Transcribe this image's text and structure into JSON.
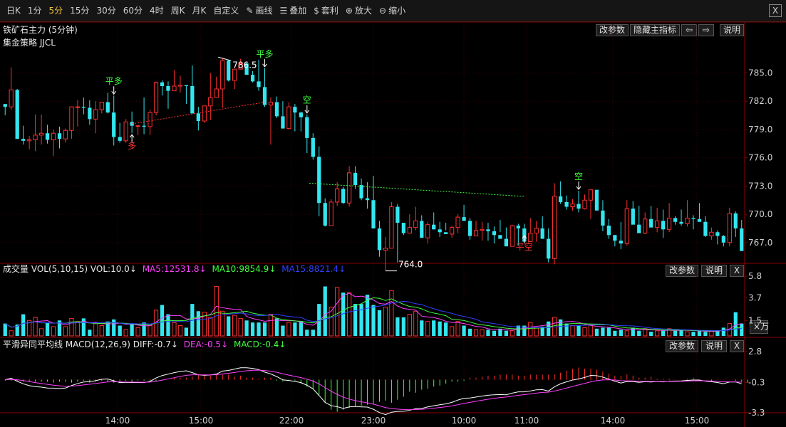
{
  "toolbar": {
    "items": [
      "日K",
      "1分",
      "5分",
      "15分",
      "30分",
      "60分",
      "4时",
      "周K",
      "月K",
      "自定义"
    ],
    "active_index": 2,
    "tools": [
      {
        "label": "画线",
        "icon": "pencil-icon"
      },
      {
        "label": "叠加",
        "icon": "stack-icon"
      },
      {
        "label": "套利",
        "icon": "money-bag-icon"
      },
      {
        "label": "放大",
        "icon": "zoom-in-icon"
      },
      {
        "label": "缩小",
        "icon": "zoom-out-icon"
      }
    ],
    "close_label": "X"
  },
  "main": {
    "title": "铁矿石主力 (5分钟)",
    "strategy": "集金策略 JJCL",
    "buttons": {
      "params": "改参数",
      "hide": "隐藏主指标",
      "prev": "⇦",
      "next": "⇨",
      "help": "说明"
    },
    "high_label": "786.5",
    "low_label": "764.0"
  },
  "vol": {
    "title": "成交量 VOL(5,10,15) VOL:10.0↓",
    "ma5": "MA5:12531.8↓",
    "ma10": "MA10:9854.9↓",
    "ma15": "MA15:8821.4↓",
    "buttons": {
      "params": "改参数",
      "help": "说明",
      "close": "X"
    },
    "unit_button": "×万"
  },
  "macd": {
    "title": "平滑异同平均线 MACD(12,26,9) DIFF:-0.7↓",
    "dea": "DEA:-0.5↓",
    "macd": "MACD:-0.4↓",
    "buttons": {
      "params": "改参数",
      "help": "说明",
      "close": "X"
    }
  },
  "colors": {
    "up": "#ff3030",
    "down": "#33e6f0",
    "ma5": "#ff40ff",
    "ma10": "#40ff40",
    "ma15": "#3040ff",
    "diff": "#ffffff",
    "dea": "#ff40ff",
    "bg": "#000000",
    "grid": "#2a0000"
  },
  "chart_data": {
    "type": "candlestick",
    "price_ylim": [
      764.0,
      786.5
    ],
    "price_ticks": [
      "785.0",
      "782.0",
      "779.0",
      "776.0",
      "773.0",
      "770.0",
      "767.0"
    ],
    "vol_ticks": [
      "5.8",
      "3.7",
      "1.5"
    ],
    "vol_ylim": [
      0,
      5.8
    ],
    "macd_ticks": [
      "2.8",
      "-0.3",
      "-3.3"
    ],
    "macd_ylim": [
      -3.3,
      2.8
    ],
    "x_ticks": [
      "14:00",
      "15:00",
      "22:00",
      "23:00",
      "10:00",
      "11:00",
      "14:00",
      "15:00"
    ],
    "signals": [
      {
        "label": "平多",
        "color": "#40ff40",
        "bar": 18
      },
      {
        "label": "多",
        "color": "#ff3030",
        "bar": 21
      },
      {
        "label": "平多",
        "color": "#40ff40",
        "bar": 43
      },
      {
        "label": "空",
        "color": "#40ff40",
        "bar": 50
      },
      {
        "label": "平空",
        "color": "#ff3030",
        "bar": 86
      },
      {
        "label": "空",
        "color": "#40ff40",
        "bar": 95
      }
    ],
    "candles": [
      [
        781.7,
        781.7,
        780.5,
        781.4
      ],
      [
        781.4,
        785.6,
        781.1,
        783.2
      ],
      [
        783.2,
        783.3,
        778.0,
        778.0
      ],
      [
        778.0,
        779.4,
        777.4,
        777.8
      ],
      [
        777.8,
        778.3,
        776.9,
        777.9
      ],
      [
        777.9,
        780.6,
        776.7,
        778.4
      ],
      [
        778.4,
        780.6,
        777.4,
        778.6
      ],
      [
        778.6,
        779.5,
        777.5,
        777.9
      ],
      [
        777.9,
        779.0,
        776.2,
        778.6
      ],
      [
        778.6,
        779.3,
        777.0,
        778.0
      ],
      [
        778.0,
        779.1,
        777.6,
        778.9
      ],
      [
        778.9,
        781.4,
        778.0,
        781.4
      ],
      [
        781.4,
        782.1,
        779.3,
        781.4
      ],
      [
        781.4,
        782.4,
        780.6,
        781.3
      ],
      [
        781.3,
        782.1,
        779.5,
        780.1
      ],
      [
        780.1,
        782.0,
        778.6,
        781.1
      ],
      [
        781.1,
        781.7,
        780.7,
        781.9
      ],
      [
        781.9,
        782.9,
        780.7,
        780.8
      ],
      [
        780.8,
        782.6,
        777.3,
        778.2
      ],
      [
        778.2,
        779.7,
        777.6,
        777.8
      ],
      [
        777.8,
        780.1,
        777.6,
        779.8
      ],
      [
        779.8,
        780.9,
        778.6,
        779.4
      ],
      [
        779.4,
        779.4,
        778.4,
        779.4
      ],
      [
        779.4,
        782.4,
        778.5,
        779.3
      ],
      [
        779.3,
        781.1,
        778.4,
        780.8
      ],
      [
        780.8,
        784.1,
        780.5,
        784.0
      ],
      [
        784.0,
        784.2,
        782.6,
        783.6
      ],
      [
        783.6,
        784.1,
        781.2,
        783.1
      ],
      [
        783.1,
        785.3,
        783.1,
        783.6
      ],
      [
        783.6,
        784.7,
        782.9,
        783.7
      ],
      [
        783.7,
        783.7,
        781.7,
        783.6
      ],
      [
        783.6,
        785.8,
        781.1,
        780.7
      ],
      [
        780.7,
        781.4,
        778.9,
        779.9
      ],
      [
        779.9,
        780.6,
        779.7,
        781.5
      ],
      [
        781.5,
        785.0,
        780.0,
        782.4
      ],
      [
        782.4,
        784.6,
        782.5,
        783.3
      ],
      [
        783.3,
        786.6,
        781.3,
        786.3
      ],
      [
        786.3,
        786.4,
        784.1,
        784.2
      ],
      [
        784.2,
        785.3,
        783.3,
        785.4
      ],
      [
        785.4,
        786.5,
        785.5,
        786.0
      ],
      [
        786.0,
        786.1,
        785.2,
        784.8
      ],
      [
        784.8,
        785.2,
        784.0,
        784.1
      ],
      [
        784.1,
        786.4,
        783.1,
        783.5
      ],
      [
        783.5,
        785.5,
        781.4,
        781.6
      ],
      [
        781.6,
        782.4,
        777.4,
        781.9
      ],
      [
        781.9,
        782.5,
        780.2,
        780.4
      ],
      [
        780.4,
        782.0,
        780.4,
        779.1
      ],
      [
        779.1,
        781.9,
        779.0,
        781.4
      ],
      [
        781.4,
        781.7,
        778.8,
        780.8
      ],
      [
        780.8,
        780.9,
        778.8,
        780.3
      ],
      [
        780.3,
        780.6,
        776.5,
        778.1
      ],
      [
        778.1,
        778.6,
        775.8,
        776.1
      ],
      [
        776.1,
        777.2,
        769.8,
        771.2
      ],
      [
        771.2,
        771.7,
        768.7,
        768.8
      ],
      [
        768.8,
        771.6,
        769.2,
        771.3
      ],
      [
        771.3,
        773.4,
        770.9,
        772.7
      ],
      [
        772.7,
        772.9,
        771.1,
        771.2
      ],
      [
        771.2,
        775.1,
        770.8,
        774.4
      ],
      [
        774.4,
        775.1,
        772.7,
        773.1
      ],
      [
        773.1,
        773.8,
        771.5,
        771.7
      ],
      [
        771.7,
        773.4,
        770.6,
        771.5
      ],
      [
        771.5,
        774.1,
        770.9,
        768.5
      ],
      [
        768.5,
        769.3,
        765.5,
        766.2
      ],
      [
        766.2,
        767.6,
        764.0,
        766.4
      ],
      [
        766.4,
        771.3,
        767.2,
        770.8
      ],
      [
        770.8,
        771.1,
        764.9,
        769.1
      ],
      [
        769.1,
        769.1,
        767.8,
        768.0
      ],
      [
        768.0,
        770.0,
        768.0,
        768.6
      ],
      [
        768.6,
        770.8,
        768.3,
        769.3
      ],
      [
        769.3,
        769.9,
        767.6,
        767.5
      ],
      [
        767.5,
        769.2,
        766.9,
        768.9
      ],
      [
        768.9,
        770.2,
        768.4,
        768.4
      ],
      [
        768.4,
        769.2,
        767.6,
        768.1
      ],
      [
        768.1,
        769.1,
        768.3,
        767.9
      ],
      [
        767.9,
        768.8,
        767.5,
        768.6
      ],
      [
        768.6,
        770.0,
        768.0,
        769.7
      ],
      [
        769.7,
        771.0,
        769.4,
        769.3
      ],
      [
        769.3,
        769.6,
        767.3,
        767.7
      ],
      [
        767.7,
        769.3,
        767.8,
        768.3
      ],
      [
        768.3,
        769.2,
        767.2,
        768.4
      ],
      [
        768.4,
        769.1,
        767.2,
        768.2
      ],
      [
        768.2,
        768.7,
        766.9,
        767.8
      ],
      [
        767.8,
        769.4,
        768.1,
        767.4
      ],
      [
        767.4,
        768.6,
        767.1,
        766.6
      ],
      [
        766.6,
        768.9,
        767.0,
        768.8
      ],
      [
        768.8,
        769.0,
        766.7,
        768.5
      ],
      [
        768.5,
        769.0,
        767.9,
        767.1
      ],
      [
        767.1,
        769.6,
        767.1,
        768.0
      ],
      [
        768.0,
        769.3,
        767.1,
        768.5
      ],
      [
        768.5,
        769.8,
        767.5,
        767.4
      ],
      [
        767.4,
        768.5,
        764.9,
        765.3
      ],
      [
        765.3,
        773.3,
        764.7,
        771.9
      ],
      [
        771.9,
        773.5,
        771.1,
        771.3
      ],
      [
        771.3,
        772.0,
        770.5,
        770.8
      ],
      [
        770.8,
        771.6,
        770.4,
        771.1
      ],
      [
        771.1,
        772.5,
        770.2,
        770.6
      ],
      [
        770.6,
        772.1,
        770.5,
        771.5
      ],
      [
        771.5,
        772.4,
        769.5,
        772.6
      ],
      [
        772.6,
        772.5,
        771.8,
        770.4
      ],
      [
        770.4,
        771.5,
        768.2,
        768.8
      ],
      [
        768.8,
        769.5,
        767.4,
        767.8
      ],
      [
        767.8,
        767.8,
        766.6,
        767.2
      ],
      [
        767.2,
        769.2,
        766.3,
        766.9
      ],
      [
        766.9,
        771.5,
        766.7,
        770.6
      ],
      [
        770.6,
        771.4,
        769.5,
        768.9
      ],
      [
        768.9,
        770.9,
        768.6,
        768.0
      ],
      [
        768.0,
        770.2,
        767.9,
        769.5
      ],
      [
        769.5,
        770.9,
        768.7,
        768.6
      ],
      [
        768.6,
        770.7,
        768.1,
        769.3
      ],
      [
        769.3,
        770.5,
        767.5,
        768.4
      ],
      [
        768.4,
        771.2,
        768.1,
        769.6
      ],
      [
        769.6,
        769.8,
        768.9,
        769.2
      ],
      [
        769.2,
        770.5,
        768.8,
        769.0
      ],
      [
        769.0,
        771.5,
        768.7,
        769.6
      ],
      [
        769.6,
        769.9,
        768.4,
        769.5
      ],
      [
        769.5,
        771.2,
        769.5,
        769.2
      ],
      [
        769.2,
        769.8,
        767.6,
        767.7
      ],
      [
        767.7,
        768.6,
        767.3,
        768.1
      ],
      [
        768.1,
        768.3,
        766.8,
        767.7
      ],
      [
        767.7,
        767.8,
        766.6,
        767.0
      ],
      [
        767.0,
        770.7,
        766.6,
        770.1
      ],
      [
        770.1,
        770.3,
        767.6,
        768.5
      ],
      [
        768.5,
        769.4,
        766.2,
        766.1
      ]
    ],
    "volumes": [
      1.2,
      0.5,
      1.1,
      2.1,
      1.5,
      1.8,
      0.7,
      1.3,
      0.9,
      1.5,
      0.9,
      1.7,
      1.4,
      1.7,
      0.6,
      1.2,
      1.0,
      1.4,
      1.6,
      1.0,
      0.6,
      1.2,
      0.8,
      1.3,
      1.0,
      2.5,
      3.0,
      2.1,
      1.3,
      1.0,
      0.8,
      3.1,
      2.4,
      2.3,
      1.8,
      4.8,
      2.4,
      1.9,
      2.0,
      1.7,
      1.5,
      1.3,
      1.3,
      1.3,
      2.1,
      1.7,
      1.0,
      1.3,
      1.3,
      1.4,
      0.6,
      0.6,
      3.1,
      4.8,
      2.8,
      4.7,
      4.2,
      4.2,
      3.1,
      3.1,
      4.0,
      3.0,
      2.5,
      2.8,
      4.4,
      1.8,
      1.8,
      2.1,
      2.4,
      1.5,
      1.4,
      1.5,
      1.4,
      1.3,
      0.9,
      1.4,
      1.0,
      0.7,
      0.6,
      0.6,
      0.6,
      0.5,
      0.7,
      0.5,
      0.5,
      1.0,
      1.0,
      1.3,
      0.8,
      0.9,
      1.4,
      1.8,
      1.6,
      1.2,
      1.0,
      1.0,
      0.8,
      1.1,
      0.7,
      0.8,
      0.8,
      0.5,
      0.6,
      0.5,
      0.8,
      0.5,
      0.7,
      0.4,
      0.5,
      0.5,
      0.7,
      0.5,
      0.6,
      0.4,
      0.4,
      0.5,
      0.4,
      0.5,
      0.5,
      0.8,
      1.2,
      2.3,
      1.2
    ],
    "macd_hist": [
      -0.1,
      -0.1,
      -0.1,
      -0.2,
      -0.2,
      -0.2,
      -0.2,
      -0.2,
      -0.3,
      -0.2,
      -0.2,
      -0.3,
      -0.2,
      -0.1,
      -0.3,
      -0.2,
      -0.1,
      -0.2,
      -0.3,
      -0.2,
      -0.1,
      -0.2,
      -0.1,
      -0.1,
      -0.1,
      -0.2,
      -0.1,
      0.0,
      0.2,
      0.2,
      0.2,
      0.3,
      0.5,
      0.5,
      0.4,
      0.5,
      0.5,
      0.5,
      0.3,
      0.4,
      0.2,
      0.2,
      0.1,
      0.2,
      0.2,
      -0.1,
      -0.2,
      -0.1,
      -0.1,
      -0.4,
      -0.7,
      -0.9,
      -1.5,
      -2.3,
      -3.0,
      -3.2,
      -3.0,
      -2.8,
      -2.7,
      -2.6,
      -2.5,
      -2.4,
      -2.2,
      -2.1,
      -2.3,
      -2.0,
      -1.7,
      -1.2,
      -1.3,
      -1.0,
      -0.9,
      -0.7,
      -0.6,
      -0.4,
      -0.2,
      -0.2,
      -0.1,
      0.2,
      0.2,
      0.3,
      0.4,
      0.4,
      0.5,
      0.5,
      0.5,
      0.4,
      0.4,
      0.5,
      0.5,
      0.5,
      0.5,
      0.5,
      0.7,
      0.9,
      1.1,
      1.2,
      1.1,
      1.1,
      1.0,
      0.8,
      0.6,
      0.4,
      0.4,
      0.5,
      0.4,
      0.2,
      0.2,
      0.3,
      0.1,
      0.1,
      0.1,
      0.0,
      0.0,
      0.1,
      0.2,
      0.0,
      0.0,
      -0.1,
      0.0,
      0.0,
      0.0,
      -0.1,
      -0.2,
      -0.3
    ]
  }
}
